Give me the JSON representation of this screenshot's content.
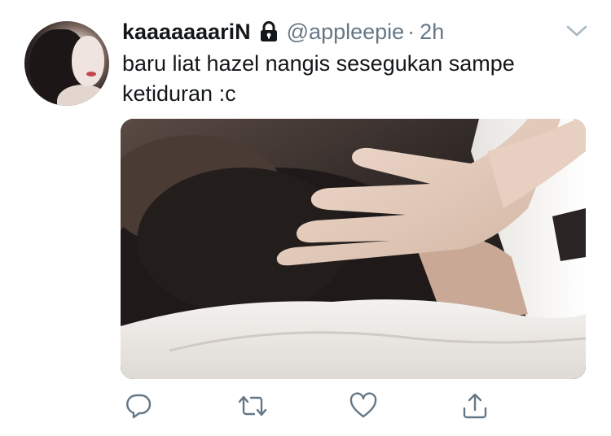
{
  "tweet": {
    "display_name": "kaaaaaaariN",
    "handle": "@appleepie",
    "separator": "·",
    "time": "2h",
    "text": "baru liat hazel nangis sesegukan sampe ketiduran :c",
    "protected_icon": "lock-icon",
    "menu_icon": "chevron-down-icon"
  },
  "actions": {
    "reply_icon": "reply-icon",
    "retweet_icon": "retweet-icon",
    "like_icon": "heart-icon",
    "share_icon": "share-icon"
  },
  "colors": {
    "text_primary": "#14171a",
    "text_secondary": "#657786",
    "icon_gray": "#657786"
  }
}
